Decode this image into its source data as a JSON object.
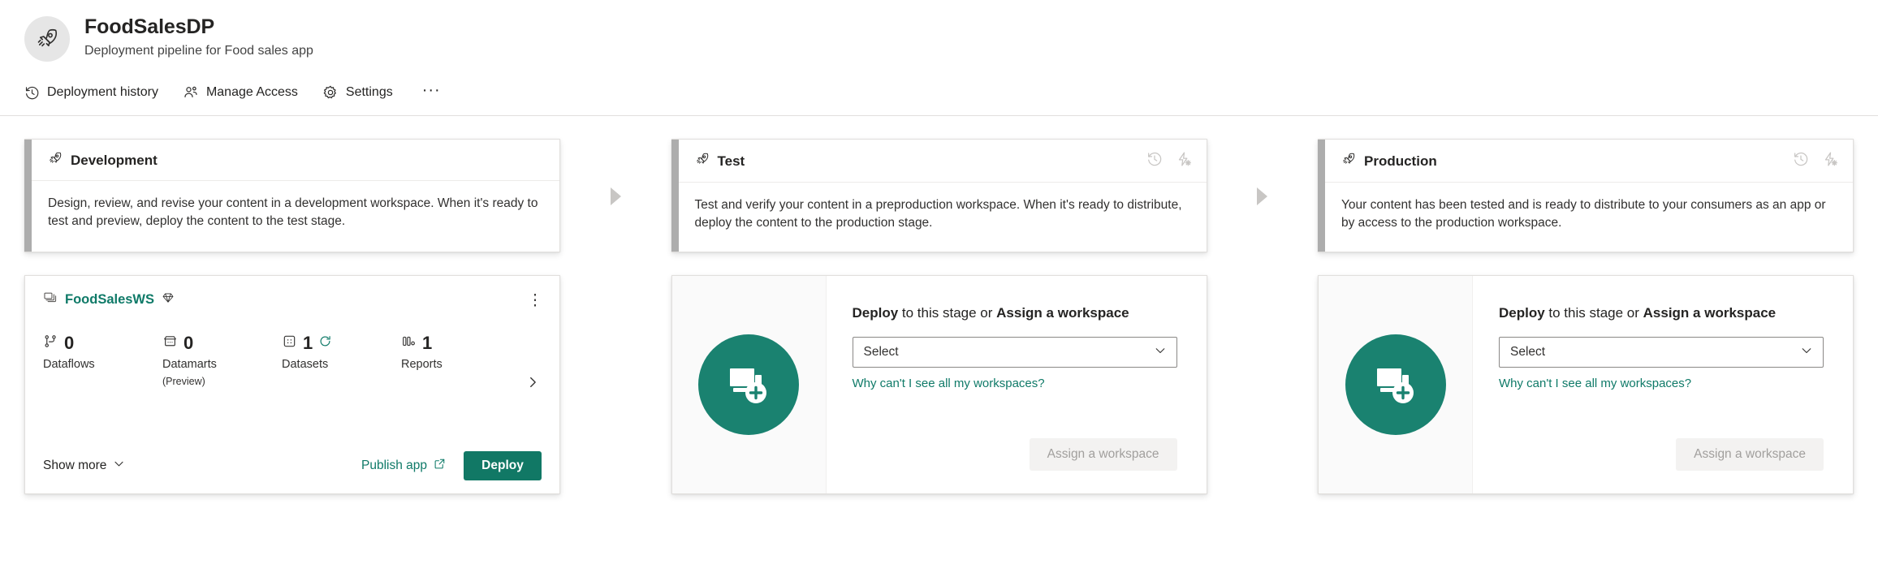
{
  "header": {
    "avatar_icon": "rocket-icon",
    "title": "FoodSalesDP",
    "subtitle": "Deployment pipeline for Food sales app",
    "toolbar": [
      {
        "label": "Deployment history",
        "icon": "history-icon"
      },
      {
        "label": "Manage Access",
        "icon": "people-icon"
      },
      {
        "label": "Settings",
        "icon": "gear-icon"
      }
    ],
    "overflow_label": "···"
  },
  "stages": [
    {
      "name": "Development",
      "icon": "rocket-icon",
      "description": "Design, review, and revise your content in a development workspace. When it's ready to test and preview, deploy the content to the test stage.",
      "has_actions": false,
      "state": "assigned"
    },
    {
      "name": "Test",
      "icon": "rocket-icon",
      "description": "Test and verify your content in a preproduction workspace. When it's ready to distribute, deploy the content to the production stage.",
      "has_actions": true,
      "state": "empty"
    },
    {
      "name": "Production",
      "icon": "rocket-icon",
      "description": "Your content has been tested and is ready to distribute to your consumers as an app or by access to the production workspace.",
      "has_actions": true,
      "state": "empty"
    }
  ],
  "workspace": {
    "icon": "workspace-icon",
    "name": "FoodSalesWS",
    "badge_icon": "premium-diamond-icon",
    "kebab_label": "⋮",
    "metrics": [
      {
        "icon": "dataflow-icon",
        "count": "0",
        "label": "Dataflows",
        "sub": ""
      },
      {
        "icon": "datamart-icon",
        "count": "0",
        "label": "Datamarts",
        "sub": "(Preview)"
      },
      {
        "icon": "dataset-icon",
        "count": "1",
        "label": "Datasets",
        "sub": "",
        "refresh_icon": "refresh-icon"
      },
      {
        "icon": "report-icon",
        "count": "1",
        "label": "Reports",
        "sub": ""
      }
    ],
    "expand_icon": "chevron-right-icon",
    "show_more_label": "Show more",
    "show_more_icon": "chevron-down-icon",
    "publish_app_label": "Publish app",
    "publish_app_icon": "external-link-icon",
    "deploy_label": "Deploy"
  },
  "empty_stage": {
    "illustration_icon": "add-workspace-icon",
    "heading_bold_1": "Deploy",
    "heading_mid": " to this stage or ",
    "heading_bold_2": "Assign a workspace",
    "select_value": "Select",
    "select_chevron_icon": "chevron-down-icon",
    "help_link": "Why can't I see all my workspaces?",
    "assign_button_label": "Assign a workspace"
  },
  "stage_actions": {
    "history_icon": "history-icon",
    "deployment_rules_icon": "deployment-rules-icon"
  },
  "colors": {
    "teal": "#117865",
    "teal_light": "#1a8270",
    "link": "#0f7a68",
    "accent_bar": "#adadad",
    "arrow": "#c8c6c4"
  }
}
